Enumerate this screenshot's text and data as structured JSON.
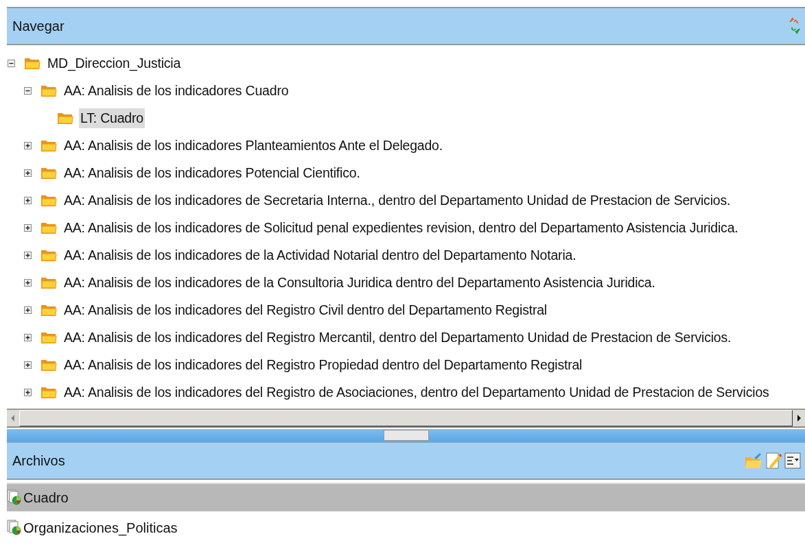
{
  "navigate_panel": {
    "title": "Navegar",
    "tree": [
      {
        "label": "MD_Direccion_Justicia",
        "expanded": true,
        "selected": false,
        "children": [
          {
            "label": "AA: Analisis de los indicadores Cuadro",
            "expanded": true,
            "selected": false,
            "children": [
              {
                "label": "LT: Cuadro",
                "selected": true
              }
            ]
          },
          {
            "label": "AA: Analisis de los indicadores Planteamientos Ante el Delegado.",
            "expanded": false,
            "selected": false
          },
          {
            "label": "AA: Analisis de los indicadores Potencial Cientifico.",
            "expanded": false,
            "selected": false
          },
          {
            "label": "AA: Analisis de los indicadores de Secretaria Interna., dentro del Departamento Unidad de Prestacion de Servicios.",
            "expanded": false,
            "selected": false
          },
          {
            "label": "AA: Analisis de los indicadores de Solicitud penal expedientes revision, dentro del Departamento Asistencia Juridica.",
            "expanded": false,
            "selected": false
          },
          {
            "label": "AA: Analisis de los indicadores de la Actividad Notarial dentro del Departamento Notaria.",
            "expanded": false,
            "selected": false
          },
          {
            "label": "AA: Analisis de los indicadores de la Consultoria Juridica dentro del Departamento Asistencia Juridica.",
            "expanded": false,
            "selected": false
          },
          {
            "label": "AA: Analisis de los indicadores del Registro Civil dentro del Departamento Registral",
            "expanded": false,
            "selected": false
          },
          {
            "label": "AA: Analisis de los indicadores del Registro Mercantil, dentro del Departamento Unidad de Prestacion de Servicios.",
            "expanded": false,
            "selected": false
          },
          {
            "label": "AA: Analisis de los indicadores del Registro Propiedad dentro del Departamento Registral",
            "expanded": false,
            "selected": false
          },
          {
            "label": "AA: Analisis de los indicadores del Registro de Asociaciones, dentro del Departamento Unidad de Prestacion de Servicios",
            "expanded": false,
            "selected": false
          }
        ]
      }
    ]
  },
  "files_panel": {
    "title": "Archivos",
    "files": [
      {
        "name": "Cuadro",
        "selected": true
      },
      {
        "name": "Organizaciones_Politicas",
        "selected": false
      }
    ]
  }
}
